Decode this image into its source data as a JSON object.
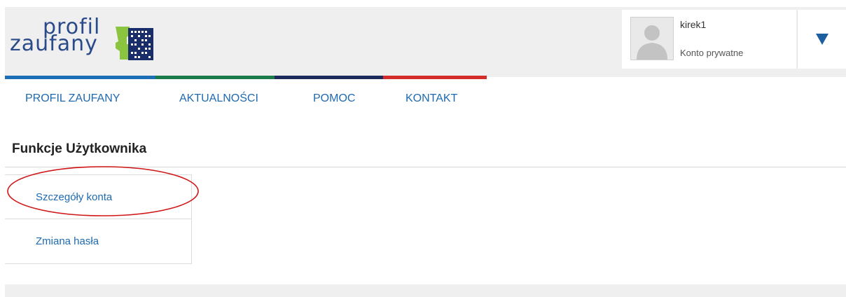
{
  "logo": {
    "line1": "profil",
    "line2": "zaufany"
  },
  "user": {
    "name": "kirek1",
    "account_type": "Konto prywatne"
  },
  "nav": {
    "items": [
      {
        "label": "PROFIL ZAUFANY"
      },
      {
        "label": "AKTUALNOŚCI"
      },
      {
        "label": "POMOC"
      },
      {
        "label": "KONTAKT"
      }
    ]
  },
  "section": {
    "title": "Funkcje Użytkownika"
  },
  "menu": {
    "items": [
      {
        "label": "Szczegóły konta"
      },
      {
        "label": "Zmiana hasła"
      }
    ]
  },
  "colors": {
    "stripe_blue": "#1c6eb5",
    "stripe_green": "#1a7a4a",
    "stripe_navy": "#1c2a5c",
    "stripe_red": "#d42b2b",
    "link": "#1e6ab0",
    "highlight": "#d01616"
  },
  "icons": {
    "dropdown": "triangle-down-icon",
    "avatar": "user-silhouette-icon",
    "logo_mark": "pz-logo-mark-icon"
  }
}
